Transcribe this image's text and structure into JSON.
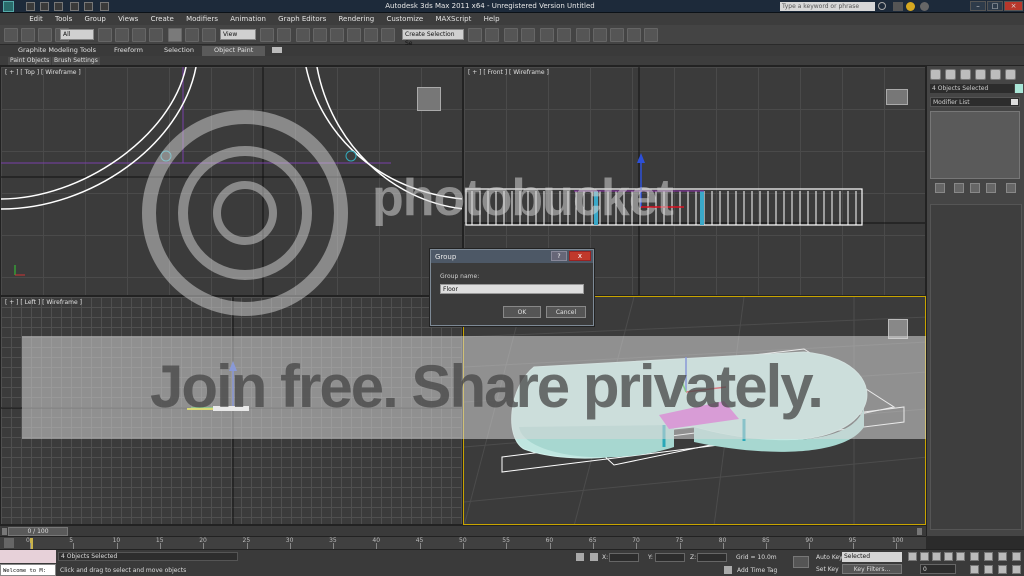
{
  "titlebar": {
    "title": "Autodesk 3ds Max 2011 x64    -  Unregistered Version   Untitled",
    "search_placeholder": "Type a keyword or phrase"
  },
  "menu": [
    "Edit",
    "Tools",
    "Group",
    "Views",
    "Create",
    "Modifiers",
    "Animation",
    "Graph Editors",
    "Rendering",
    "Customize",
    "MAXScript",
    "Help"
  ],
  "toolbar": {
    "filter_value": "All",
    "refcoord_value": "View",
    "selset_value": "Create Selection Se"
  },
  "ribbon": {
    "tabs": [
      "Graphite Modeling Tools",
      "Freeform",
      "Selection",
      "Object Paint"
    ],
    "active": "Object Paint",
    "subtabs": [
      "Paint Objects",
      "Brush Settings"
    ]
  },
  "viewports": {
    "top": "[ + ] [ Top ] [ Wireframe ]",
    "front": "[ + ] [ Front ] [ Wireframe ]",
    "left": "[ + ] [ Left ] [ Wireframe ]"
  },
  "watermark": {
    "brand": "photobucket",
    "tagline": "Join free. Share privately."
  },
  "command_panel": {
    "objects_selected": "4 Objects Selected",
    "modifier_list": "Modifier List"
  },
  "dialog": {
    "title": "Group",
    "help": "?",
    "close": "x",
    "group_name_label": "Group name:",
    "group_name_value": "Floor",
    "ok": "OK",
    "cancel": "Cancel"
  },
  "timeline": {
    "thumb": "0 / 100",
    "ticks": [
      "0",
      "5",
      "10",
      "15",
      "20",
      "25",
      "30",
      "35",
      "40",
      "45",
      "50",
      "55",
      "60",
      "65",
      "70",
      "75",
      "80",
      "85",
      "90",
      "95",
      "100"
    ]
  },
  "status": {
    "maxscript": "Welcome to M:",
    "selected": "4 Objects Selected",
    "prompt": "Click and drag to select and move objects",
    "x_label": "X:",
    "y_label": "Y:",
    "z_label": "Z:",
    "grid": "Grid = 10.0m",
    "add_time_tag": "Add Time Tag",
    "auto_key": "Auto Key",
    "set_key": "Set Key",
    "selected_dropdown": "Selected",
    "key_filters": "Key Filters...",
    "frame": "0"
  },
  "colors": {
    "selection_cyan": "#a9e6d7",
    "selection_magenta": "#d955d6",
    "active_viewport": "#c8a400"
  }
}
